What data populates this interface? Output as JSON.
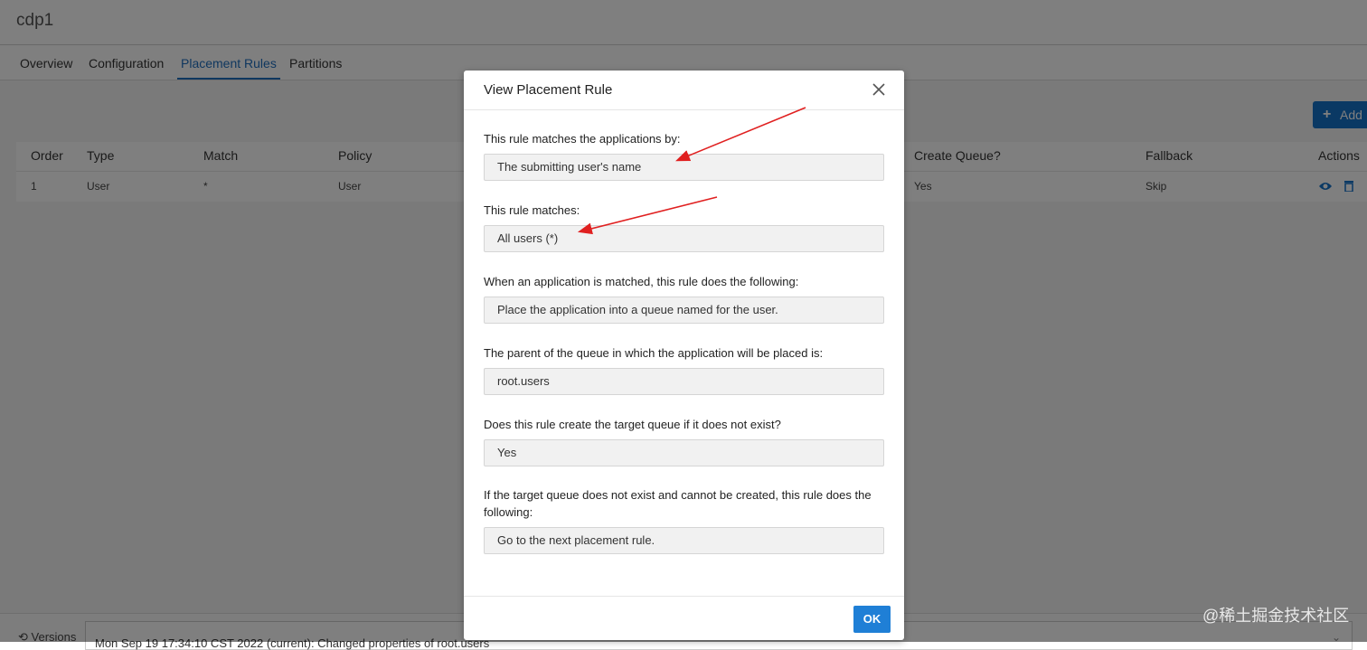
{
  "app": {
    "title": "cdp1"
  },
  "tabs": [
    {
      "label": "Overview"
    },
    {
      "label": "Configuration"
    },
    {
      "label": "Placement Rules"
    },
    {
      "label": "Partitions"
    }
  ],
  "toolbar": {
    "add_label": "Add",
    "add_icon": "plus-icon"
  },
  "table": {
    "headers": [
      "Order",
      "Type",
      "Match",
      "Policy",
      "Create Queue?",
      "Fallback",
      "Actions"
    ],
    "rows": [
      {
        "order": "1",
        "type": "User",
        "match": "*",
        "policy": "User",
        "create_queue": "Yes",
        "fallback": "Skip"
      }
    ],
    "action_icons": [
      "eye-icon",
      "trash-icon"
    ]
  },
  "footer": {
    "versions_label": "Versions",
    "version_value": "Mon Sep 19 17:34:10 CST 2022 (current): Changed properties of root.users"
  },
  "modal": {
    "title": "View Placement Rule",
    "fields": [
      {
        "label": "This rule matches the applications by:",
        "value": "The submitting user's name"
      },
      {
        "label": "This rule matches:",
        "value": "All users (*)"
      },
      {
        "label": "When an application is matched, this rule does the following:",
        "value": "Place the application into a queue named for the user."
      },
      {
        "label": "The parent of the queue in which the application will be placed is:",
        "value": "root.users"
      },
      {
        "label": "Does this rule create the target queue if it does not exist?",
        "value": "Yes"
      },
      {
        "label": "If the target queue does not exist and cannot be created, this rule does the following:",
        "value": "Go to the next placement rule."
      }
    ],
    "ok_label": "OK"
  },
  "watermark": "@稀土掘金技术社区",
  "colors": {
    "accent": "#1572c9",
    "annotation_arrow": "#e02020"
  }
}
